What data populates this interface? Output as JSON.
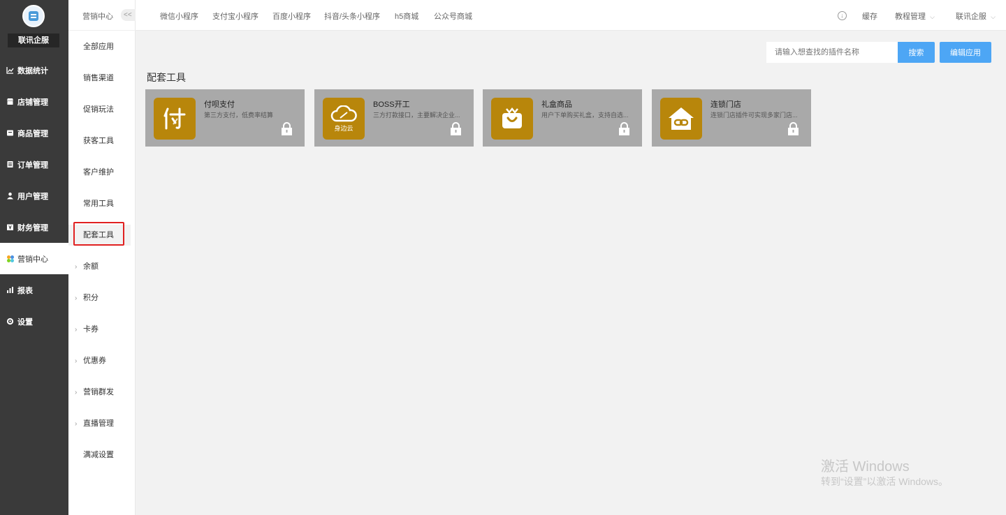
{
  "brand": {
    "name": "联讯企服"
  },
  "sidebar": {
    "items": [
      {
        "label": "数据统计",
        "icon": "chart-line-icon"
      },
      {
        "label": "店铺管理",
        "icon": "store-icon"
      },
      {
        "label": "商品管理",
        "icon": "goods-icon"
      },
      {
        "label": "订单管理",
        "icon": "order-icon"
      },
      {
        "label": "用户管理",
        "icon": "user-icon"
      },
      {
        "label": "财务管理",
        "icon": "finance-icon"
      },
      {
        "label": "营销中心",
        "icon": "marketing-icon",
        "active": true
      },
      {
        "label": "报表",
        "icon": "report-icon"
      },
      {
        "label": "设置",
        "icon": "gear-icon"
      }
    ]
  },
  "subnav": {
    "title": "营销中心",
    "collapse": "<<",
    "items": [
      {
        "label": "全部应用"
      },
      {
        "label": "销售渠道"
      },
      {
        "label": "促销玩法"
      },
      {
        "label": "获客工具"
      },
      {
        "label": "客户维护"
      },
      {
        "label": "常用工具"
      },
      {
        "label": "配套工具",
        "active": true
      },
      {
        "label": "余额",
        "expandable": true
      },
      {
        "label": "积分",
        "expandable": true
      },
      {
        "label": "卡券",
        "expandable": true
      },
      {
        "label": "优惠券",
        "expandable": true
      },
      {
        "label": "营销群发",
        "expandable": true
      },
      {
        "label": "直播管理",
        "expandable": true
      },
      {
        "label": "满减设置"
      }
    ]
  },
  "topbar": {
    "tabs": [
      "微信小程序",
      "支付宝小程序",
      "百度小程序",
      "抖音/头条小程序",
      "h5商城",
      "公众号商城"
    ],
    "cache": "缓存",
    "tutorial": "教程管理",
    "account": "联讯企服"
  },
  "toolbar": {
    "search_placeholder": "请输入想查找的插件名称",
    "search_label": "搜索",
    "edit_label": "编辑应用"
  },
  "section": {
    "title": "配套工具"
  },
  "cards": [
    {
      "name": "付呗支付",
      "desc": "第三方支付，低费率结算",
      "icon": "fubei-pay-icon"
    },
    {
      "name": "BOSS开工",
      "desc": "三方打款接口，主要解决企业...",
      "icon": "cloud-icon",
      "icon_text": "身边云"
    },
    {
      "name": "礼盒商品",
      "desc": "用户下单购买礼盒，支持自选...",
      "icon": "gift-bag-icon"
    },
    {
      "name": "连锁门店",
      "desc": "连锁门店插件可实现多家门店...",
      "icon": "chain-store-icon"
    }
  ],
  "watermark": {
    "line1": "激活 Windows",
    "line2": "转到“设置”以激活 Windows。"
  },
  "colors": {
    "sidebar_bg": "#3a3a3a",
    "accent": "#4da6f5",
    "card_bg": "#a9a9a9",
    "icon_bg": "#b8860b",
    "highlight": "#e02020"
  }
}
